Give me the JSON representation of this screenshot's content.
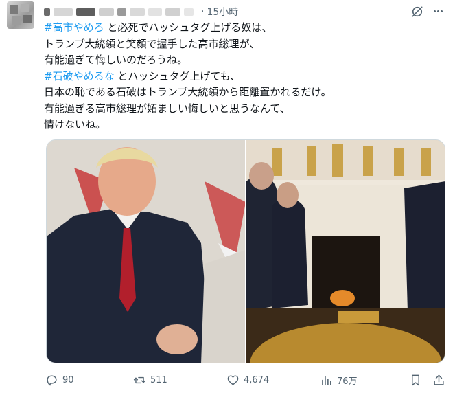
{
  "tweet": {
    "time_dot": "·",
    "time": "15小時",
    "lines": [
      {
        "hashtag": "#高市やめろ",
        "text": " と必死でハッシュタグ上げる奴は、"
      },
      {
        "hashtag": "",
        "text": "トランプ大統領と笑顔で握手した高市総理が、"
      },
      {
        "hashtag": "",
        "text": "有能過ぎて悔しいのだろうね。"
      },
      {
        "hashtag": "#石破やめるな",
        "text": " とハッシュタグ上げても、"
      },
      {
        "hashtag": "",
        "text": "日本の恥である石破はトランプ大統領から距離置かれるだけ。"
      },
      {
        "hashtag": "",
        "text": "有能過ぎる高市総理が妬ましい悔しいと思うなんて、"
      },
      {
        "hashtag": "",
        "text": "情けないね。"
      }
    ]
  },
  "stats": {
    "replies": "90",
    "reposts": "511",
    "likes": "4,674",
    "views": "76万"
  },
  "colors": {
    "hashtag": "#1d9bf0",
    "secondary_text": "#536471",
    "main_text": "#0f1419"
  },
  "icons": [
    "avatar",
    "grok-icon",
    "more-icon",
    "reply-icon",
    "repost-icon",
    "like-icon",
    "views-icon",
    "bookmark-icon",
    "share-icon"
  ]
}
